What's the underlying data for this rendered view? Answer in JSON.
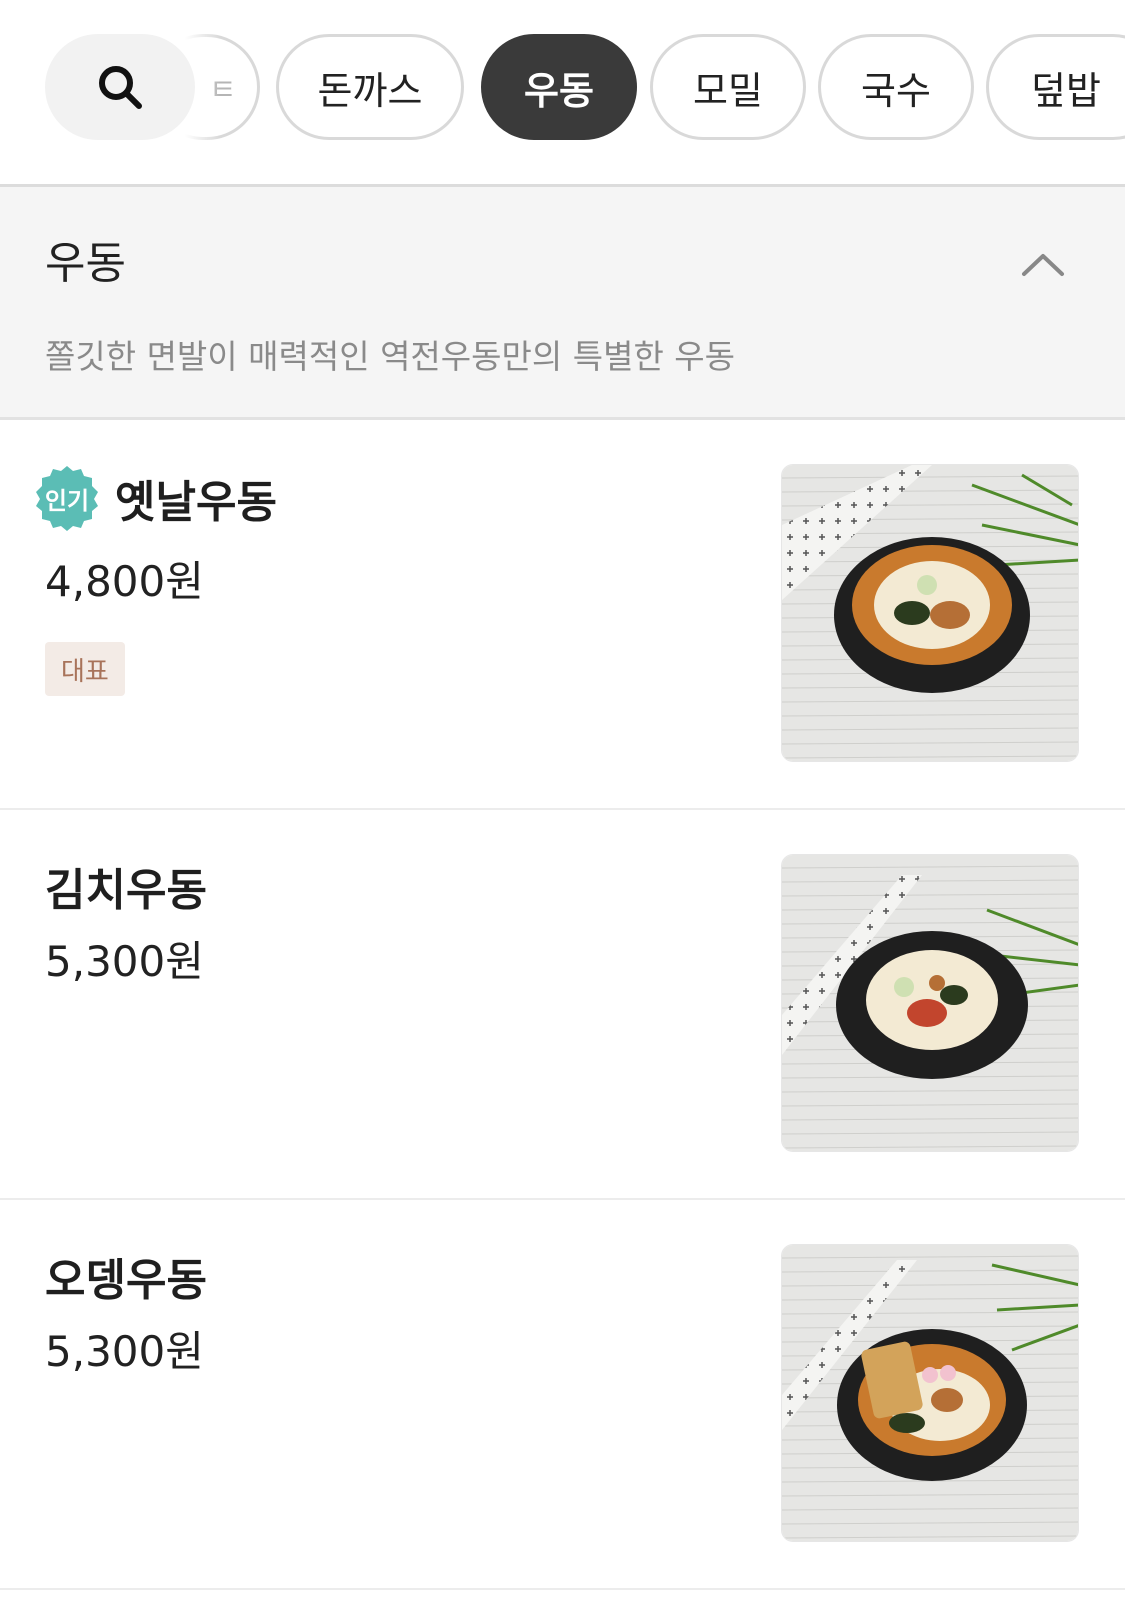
{
  "categories": {
    "partial_label": "ㅌ",
    "chips": [
      {
        "label": "돈까스",
        "active": false
      },
      {
        "label": "우동",
        "active": true
      },
      {
        "label": "모밀",
        "active": false
      },
      {
        "label": "국수",
        "active": false
      },
      {
        "label": "덮밥",
        "active": false
      }
    ]
  },
  "section": {
    "title": "우동",
    "description": "쫄깃한 면발이 매력적인 역전우동만의 특별한 우동"
  },
  "menu_items": [
    {
      "name": "옛날우동",
      "price": "4,800원",
      "badge": "인기",
      "tag": "대표"
    },
    {
      "name": "김치우동",
      "price": "5,300원"
    },
    {
      "name": "오뎅우동",
      "price": "5,300원"
    }
  ],
  "colors": {
    "active_chip": "#3a3a3a",
    "badge": "#5bbdb5",
    "tag_bg": "#f3ebe6",
    "tag_text": "#a8735a"
  }
}
